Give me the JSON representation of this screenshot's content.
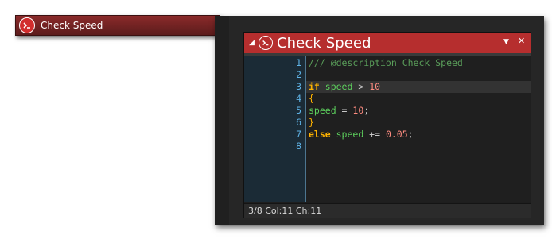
{
  "chip": {
    "label": "Check Speed"
  },
  "editor": {
    "title": "Check Speed",
    "collapse_glyph": "◢",
    "menu_glyph": "▼",
    "close_glyph": "✕",
    "current_line_marker": "›",
    "status": "3/8 Col:11 Ch:11",
    "lines": [
      {
        "n": "1",
        "tokens": [
          {
            "t": "/// @description Check Speed",
            "c": "c-comment"
          }
        ]
      },
      {
        "n": "2",
        "tokens": []
      },
      {
        "n": "3",
        "tokens": [
          {
            "t": "if ",
            "c": "c-kw"
          },
          {
            "t": "speed",
            "c": "c-var"
          },
          {
            "t": " > ",
            "c": "c-op"
          },
          {
            "t": "10",
            "c": "c-num"
          }
        ]
      },
      {
        "n": "4",
        "tokens": [
          {
            "t": "{",
            "c": "c-brace"
          }
        ]
      },
      {
        "n": "5",
        "tokens": [
          {
            "t": "speed",
            "c": "c-var"
          },
          {
            "t": " = ",
            "c": "c-op"
          },
          {
            "t": "10",
            "c": "c-num"
          },
          {
            "t": ";",
            "c": "c-op"
          }
        ]
      },
      {
        "n": "6",
        "tokens": [
          {
            "t": "}",
            "c": "c-brace"
          }
        ]
      },
      {
        "n": "7",
        "tokens": [
          {
            "t": "else ",
            "c": "c-kw"
          },
          {
            "t": "speed",
            "c": "c-var"
          },
          {
            "t": " += ",
            "c": "c-op"
          },
          {
            "t": "0.05",
            "c": "c-num"
          },
          {
            "t": ";",
            "c": "c-op"
          }
        ]
      },
      {
        "n": "8",
        "tokens": []
      }
    ],
    "highlighted_line": "3"
  },
  "colors": {
    "title_bar": "#b62e2e",
    "chip": "#8a2a2a",
    "keyword": "#ffb300",
    "variable": "#5dd05d",
    "number": "#ff8c80",
    "comment": "#5a9e5a",
    "line_number": "#5fb3e6"
  },
  "icons": {
    "script": "script-icon"
  }
}
